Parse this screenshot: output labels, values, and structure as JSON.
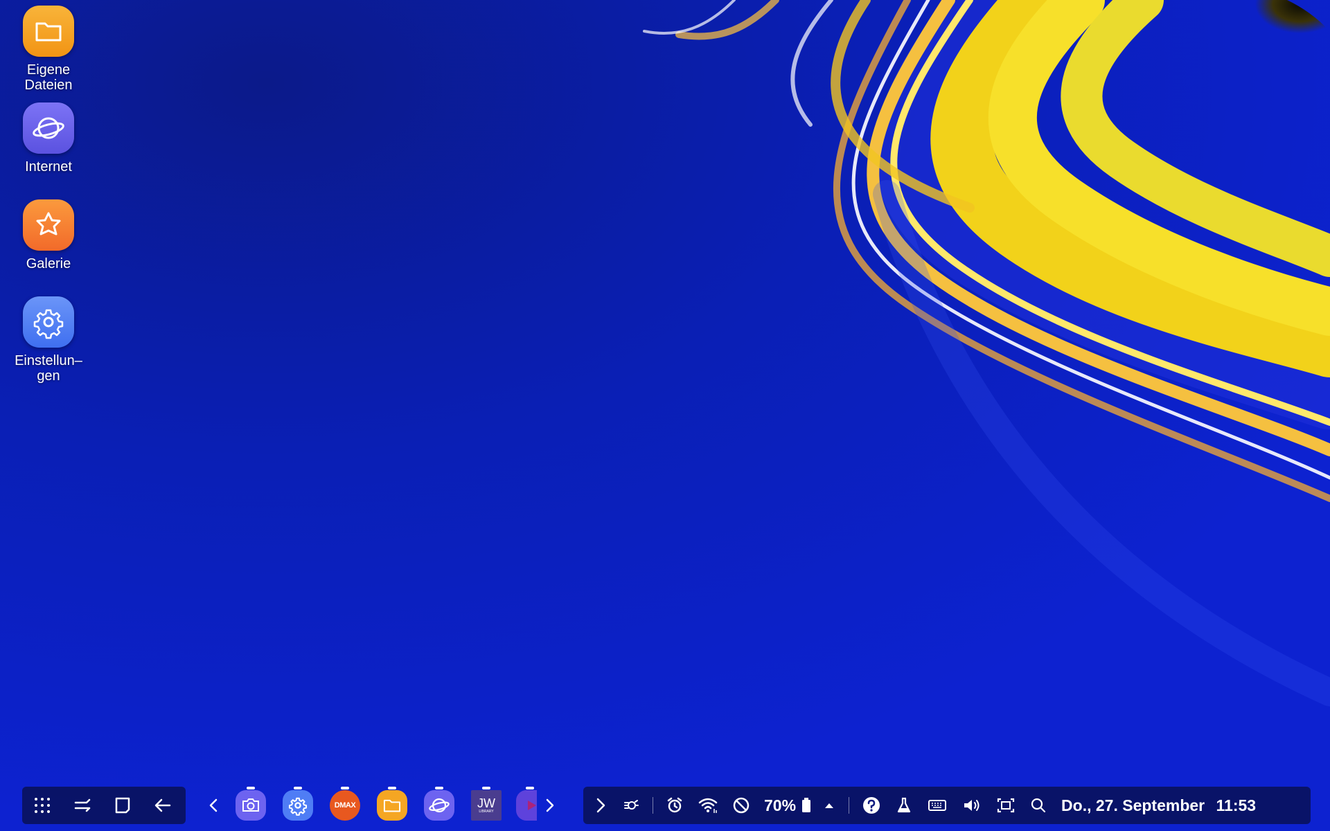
{
  "desktop": {
    "icons": [
      {
        "label": "Eigene\nDateien",
        "icon": "folder-icon",
        "color": "#f5a623"
      },
      {
        "label": "Internet",
        "icon": "planet-icon",
        "color": "#6d63f0"
      },
      {
        "label": "Galerie",
        "icon": "flower-icon",
        "color": "#f5962b"
      },
      {
        "label": "Einstellun–\ngen",
        "icon": "gear-icon",
        "color": "#4f7df5"
      }
    ]
  },
  "taskbar": {
    "nav": [
      {
        "name": "apps-button",
        "icon": "grid-dots-icon"
      },
      {
        "name": "recents-button",
        "icon": "recents-icon"
      },
      {
        "name": "home-button",
        "icon": "home-square-icon"
      },
      {
        "name": "back-button",
        "icon": "back-arrow-icon"
      }
    ],
    "apps": [
      {
        "name": "camera",
        "icon": "camera-icon",
        "color": "#6d63f0",
        "running": true
      },
      {
        "name": "settings",
        "icon": "gear-icon",
        "color": "#4f7df5",
        "running": true
      },
      {
        "name": "dmax",
        "text": "DMAX",
        "color": "#e8581f",
        "running": true
      },
      {
        "name": "my-files",
        "icon": "folder-icon",
        "color": "#f5a623",
        "running": true
      },
      {
        "name": "internet",
        "icon": "planet-icon",
        "color": "#6d63f0",
        "running": true
      },
      {
        "name": "jw-library",
        "text": "JW",
        "subtext": "LIBRARY",
        "color": "#4a3d8f",
        "running": true
      },
      {
        "name": "video",
        "icon": "play-icon",
        "color": "#7a4de0",
        "running": true
      }
    ],
    "tray": {
      "battery_percent": "70%",
      "date": "Do., 27. September",
      "time": "11:53"
    }
  }
}
